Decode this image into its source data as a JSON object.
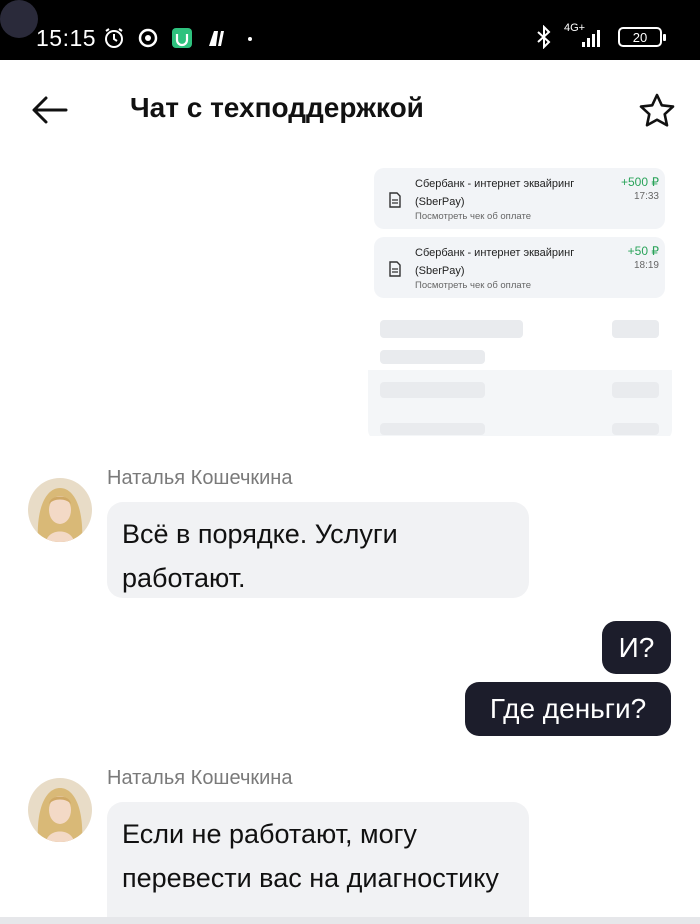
{
  "status_bar": {
    "time": "15:15",
    "network": "4G+",
    "battery": "20",
    "icons": [
      "alarm-icon",
      "vpn-icon",
      "app-badge-icon",
      "app-logo-icon",
      "dot-icon",
      "bluetooth-icon",
      "signal-icon",
      "battery-icon"
    ]
  },
  "header": {
    "title": "Чат с техподдержкой",
    "back_icon": "arrow-left-icon",
    "favorite_icon": "star-icon"
  },
  "receipt_image": {
    "transactions": [
      {
        "merchant": "Сбербанк - интернет эквайринг (SberPay)",
        "amount": "+500 ₽",
        "time": "17:33",
        "link": "Посмотреть чек об оплате",
        "icon": "document-icon"
      },
      {
        "merchant": "Сбербанк - интернет эквайринг (SberPay)",
        "amount": "+50 ₽",
        "time": "18:19",
        "link": "Посмотреть чек об оплате",
        "icon": "document-icon"
      }
    ]
  },
  "messages": [
    {
      "direction": "in",
      "sender": "Наталья Кошечкина",
      "text": "Всё в порядке. Услуги работают."
    },
    {
      "direction": "out",
      "text": "И?"
    },
    {
      "direction": "out",
      "text": "Где деньги?"
    },
    {
      "direction": "in",
      "sender": "Наталья Кошечкина",
      "text": "Если не работают, могу перевести вас на диагностику"
    }
  ],
  "colors": {
    "status_bar_bg": "#000000",
    "outgoing_bubble": "#1c1d2b",
    "incoming_bubble": "#f1f2f4",
    "amount_positive": "#2aa35a",
    "sender_name": "#7a7a7a"
  }
}
